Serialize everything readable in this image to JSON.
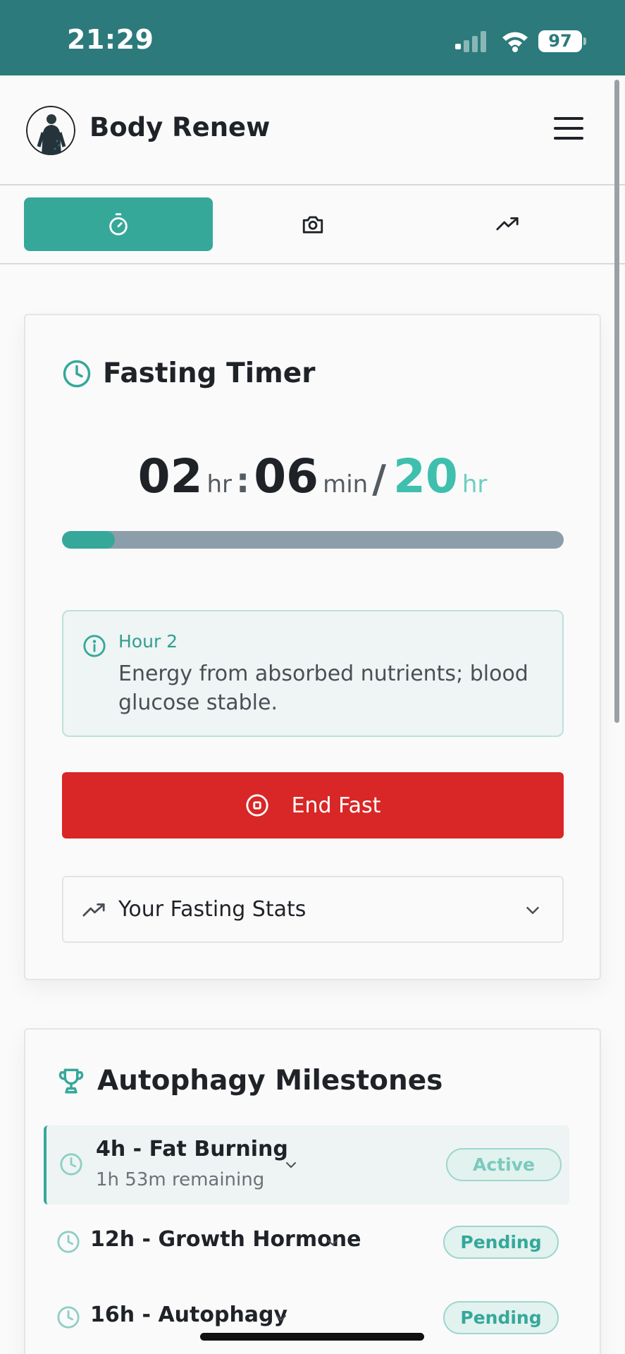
{
  "status_bar": {
    "time": "21:29",
    "battery": "97"
  },
  "header": {
    "title": "Body Renew"
  },
  "tabs": [
    {
      "name": "timer",
      "icon": "stopwatch-icon",
      "active": true
    },
    {
      "name": "photos",
      "icon": "camera-icon",
      "active": false
    },
    {
      "name": "progress",
      "icon": "trending-up-icon",
      "active": false
    }
  ],
  "timer": {
    "title": "Fasting Timer",
    "hours": "02",
    "hours_unit": "hr",
    "minutes": "06",
    "minutes_unit": "min",
    "goal": "20",
    "goal_unit": "hr",
    "progress_fraction": 0.105,
    "phase_title": "Hour 2",
    "phase_text": "Energy from absorbed nutrients; blood glucose stable.",
    "end_label": "End Fast",
    "stats_label": "Your Fasting Stats"
  },
  "milestones": {
    "title": "Autophagy Milestones",
    "items": [
      {
        "title": "4h - Fat Burning",
        "subtitle": "1h 53m remaining",
        "status": "Active"
      },
      {
        "title": "12h - Growth Hormone",
        "status": "Pending"
      },
      {
        "title": "16h - Autophagy",
        "status": "Pending"
      }
    ]
  },
  "colors": {
    "status_bar": "#2c7a7b",
    "accent": "#35a89a",
    "danger": "#d92626"
  }
}
